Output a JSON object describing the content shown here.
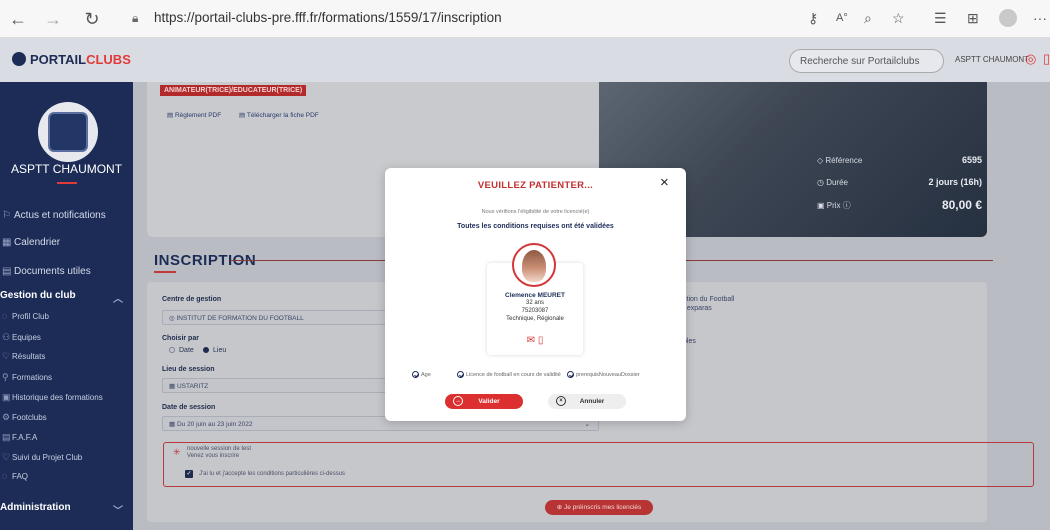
{
  "browser": {
    "url": "https://portail-clubs-pre.fff.fr/formations/1559/17/inscription",
    "icons": [
      "back-icon",
      "forward-icon",
      "refresh-icon",
      "lock-icon",
      "key-icon",
      "read-aloud-icon",
      "zoom-icon",
      "favorite-icon",
      "favorites-list-icon",
      "collections-icon",
      "profile-icon",
      "more-icon"
    ],
    "more_label": "···"
  },
  "header": {
    "logo_text_1": "PORTAIL",
    "logo_text_2": "CLUBS",
    "search_placeholder": "Recherche sur Portailclubs",
    "club_name": "ASPTT CHAUMONT"
  },
  "sidebar": {
    "club_name": "ASPTT CHAUMONT",
    "items": [
      {
        "label": "Actus et notifications",
        "icon": "bell-icon"
      },
      {
        "label": "Calendrier",
        "icon": "calendar-icon"
      },
      {
        "label": "Documents utiles",
        "icon": "document-icon"
      }
    ],
    "section_gestion": "Gestion du club",
    "sub_items": [
      {
        "label": "Profil Club",
        "icon": "shield-icon"
      },
      {
        "label": "Equipes",
        "icon": "team-icon"
      },
      {
        "label": "Résultats",
        "icon": "trophy-icon"
      },
      {
        "label": "Formations",
        "icon": "graduation-icon"
      },
      {
        "label": "Historique des formations",
        "icon": "history-icon"
      },
      {
        "label": "Footclubs",
        "icon": "footclubs-icon"
      },
      {
        "label": "F.A.F.A",
        "icon": "fafa-icon"
      },
      {
        "label": "Suivi du Projet Club",
        "icon": "project-icon"
      },
      {
        "label": "FAQ",
        "icon": "help-icon"
      }
    ],
    "section_admin": "Administration"
  },
  "formation": {
    "tag": "ANIMATEUR(TRICE)/EDUCATEUR(TRICE)",
    "doc1": "Règlement PDF",
    "doc2": "Télécharger la fiche PDF",
    "reference_label": "Référence",
    "reference_value": "6595",
    "duree_label": "Durée",
    "duree_value": "2 jours (16h)",
    "prix_label": "Prix ⓘ",
    "prix_value": "80,00 €"
  },
  "inscription": {
    "title": "INSCRIPTION",
    "centre_label": "Centre de gestion",
    "centre_value": "INSTITUT DE FORMATION DU FOOTBALL",
    "choisir_label": "Choisir par",
    "radio_date": "Date",
    "radio_lieu": "Lieu",
    "lieu_label": "Lieu de session",
    "lieu_value": "USTARITZ",
    "date_label": "Date de session",
    "date_value": "Du 20 juin au 23 juin 2022",
    "right_text_1": "ction du Football",
    "right_text_2": "t exparas",
    "right_text_3": "bles",
    "notice_1": "nouvelle session de test",
    "notice_2": "Venez vous inscrire",
    "accept_label": "J'ai lu et j'accepte les conditions particulières ci-dessus",
    "premount_label": "Je préinscris mes licenciés"
  },
  "modal": {
    "title": "VEUILLEZ PATIENTER...",
    "subtitle": "Nous vérifions l'éligibilité de votre licencié(e)",
    "status": "Toutes les conditions requises ont été validées",
    "person_name": "Clemence MEURET",
    "person_age": "32 ans",
    "person_id": "75203087",
    "person_role": "Technique, Régionale",
    "conditions": [
      "Age",
      "Licence de football en cours de validité",
      "prerequisNouveauDossier"
    ],
    "btn_valider": "Valider",
    "btn_annuler": "Annuler"
  }
}
